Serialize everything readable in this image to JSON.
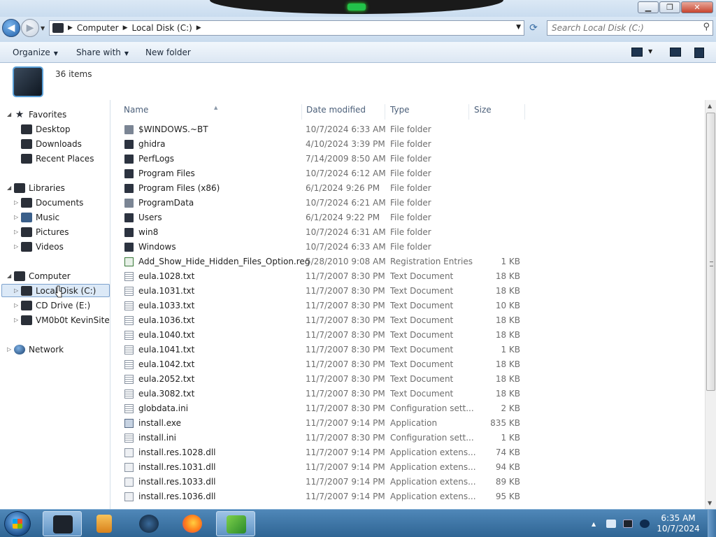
{
  "window": {
    "minimize_glyph": "▁",
    "maximize_glyph": "❐",
    "close_glyph": "✕"
  },
  "address": {
    "back_glyph": "◀",
    "forward_glyph": "▶",
    "crumbs": [
      "Computer",
      "Local Disk (C:)"
    ],
    "search_placeholder": "Search Local Disk (C:)"
  },
  "toolbar": {
    "organize": "Organize",
    "share_with": "Share with",
    "new_folder": "New folder"
  },
  "details": {
    "item_count": "36 items"
  },
  "nav": {
    "favorites": "Favorites",
    "desktop": "Desktop",
    "downloads": "Downloads",
    "recent_places": "Recent Places",
    "libraries": "Libraries",
    "documents": "Documents",
    "music": "Music",
    "pictures": "Pictures",
    "videos": "Videos",
    "computer": "Computer",
    "local_disk": "Local Disk (C:)",
    "cd_drive": "CD Drive (E:)",
    "vm_site": "VM0b0t KevinSite",
    "network": "Network"
  },
  "columns": {
    "name": "Name",
    "date": "Date modified",
    "type": "Type",
    "size": "Size"
  },
  "files": [
    {
      "icon": "folder-light",
      "name": "$WINDOWS.~BT",
      "date": "10/7/2024 6:33 AM",
      "type": "File folder",
      "size": ""
    },
    {
      "icon": "folder",
      "name": "ghidra",
      "date": "4/10/2024 3:39 PM",
      "type": "File folder",
      "size": ""
    },
    {
      "icon": "folder",
      "name": "PerfLogs",
      "date": "7/14/2009 8:50 AM",
      "type": "File folder",
      "size": ""
    },
    {
      "icon": "folder",
      "name": "Program Files",
      "date": "10/7/2024 6:12 AM",
      "type": "File folder",
      "size": ""
    },
    {
      "icon": "folder",
      "name": "Program Files (x86)",
      "date": "6/1/2024 9:26 PM",
      "type": "File folder",
      "size": ""
    },
    {
      "icon": "folder-light",
      "name": "ProgramData",
      "date": "10/7/2024 6:21 AM",
      "type": "File folder",
      "size": ""
    },
    {
      "icon": "folder",
      "name": "Users",
      "date": "6/1/2024 9:22 PM",
      "type": "File folder",
      "size": ""
    },
    {
      "icon": "folder",
      "name": "win8",
      "date": "10/7/2024 6:31 AM",
      "type": "File folder",
      "size": ""
    },
    {
      "icon": "folder",
      "name": "Windows",
      "date": "10/7/2024 6:33 AM",
      "type": "File folder",
      "size": ""
    },
    {
      "icon": "reg",
      "name": "Add_Show_Hide_Hidden_Files_Option.reg",
      "date": "5/28/2010 9:08 AM",
      "type": "Registration Entries",
      "size": "1 KB"
    },
    {
      "icon": "doc",
      "name": "eula.1028.txt",
      "date": "11/7/2007 8:30 PM",
      "type": "Text Document",
      "size": "18 KB"
    },
    {
      "icon": "doc",
      "name": "eula.1031.txt",
      "date": "11/7/2007 8:30 PM",
      "type": "Text Document",
      "size": "18 KB"
    },
    {
      "icon": "doc",
      "name": "eula.1033.txt",
      "date": "11/7/2007 8:30 PM",
      "type": "Text Document",
      "size": "10 KB"
    },
    {
      "icon": "doc",
      "name": "eula.1036.txt",
      "date": "11/7/2007 8:30 PM",
      "type": "Text Document",
      "size": "18 KB"
    },
    {
      "icon": "doc",
      "name": "eula.1040.txt",
      "date": "11/7/2007 8:30 PM",
      "type": "Text Document",
      "size": "18 KB"
    },
    {
      "icon": "doc",
      "name": "eula.1041.txt",
      "date": "11/7/2007 8:30 PM",
      "type": "Text Document",
      "size": "1 KB"
    },
    {
      "icon": "doc",
      "name": "eula.1042.txt",
      "date": "11/7/2007 8:30 PM",
      "type": "Text Document",
      "size": "18 KB"
    },
    {
      "icon": "doc",
      "name": "eula.2052.txt",
      "date": "11/7/2007 8:30 PM",
      "type": "Text Document",
      "size": "18 KB"
    },
    {
      "icon": "doc",
      "name": "eula.3082.txt",
      "date": "11/7/2007 8:30 PM",
      "type": "Text Document",
      "size": "18 KB"
    },
    {
      "icon": "doc",
      "name": "globdata.ini",
      "date": "11/7/2007 8:30 PM",
      "type": "Configuration sett...",
      "size": "2 KB"
    },
    {
      "icon": "exe",
      "name": "install.exe",
      "date": "11/7/2007 9:14 PM",
      "type": "Application",
      "size": "835 KB"
    },
    {
      "icon": "doc",
      "name": "install.ini",
      "date": "11/7/2007 8:30 PM",
      "type": "Configuration sett...",
      "size": "1 KB"
    },
    {
      "icon": "dll",
      "name": "install.res.1028.dll",
      "date": "11/7/2007 9:14 PM",
      "type": "Application extens...",
      "size": "74 KB"
    },
    {
      "icon": "dll",
      "name": "install.res.1031.dll",
      "date": "11/7/2007 9:14 PM",
      "type": "Application extens...",
      "size": "94 KB"
    },
    {
      "icon": "dll",
      "name": "install.res.1033.dll",
      "date": "11/7/2007 9:14 PM",
      "type": "Application extens...",
      "size": "89 KB"
    },
    {
      "icon": "dll",
      "name": "install.res.1036.dll",
      "date": "11/7/2007 9:14 PM",
      "type": "Application extens...",
      "size": "95 KB"
    }
  ],
  "taskbar": {
    "time": "6:35 AM",
    "date": "10/7/2024"
  },
  "colors": {
    "accent": "#3a6ea5",
    "taskbar": "#2f6594",
    "selection": "#dce9f7"
  }
}
